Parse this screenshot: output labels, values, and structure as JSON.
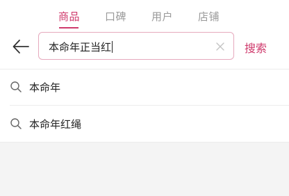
{
  "tabs": [
    {
      "label": "商品",
      "active": true
    },
    {
      "label": "口碑",
      "active": false
    },
    {
      "label": "用户",
      "active": false
    },
    {
      "label": "店铺",
      "active": false
    }
  ],
  "search": {
    "value": "本命年正当红",
    "button_label": "搜索"
  },
  "suggestions": [
    {
      "text": "本命年"
    },
    {
      "text": "本命年红绳"
    }
  ],
  "icons": {
    "back": "arrow-left-icon",
    "clear": "close-icon",
    "suggestion": "search-icon"
  },
  "colors": {
    "accent": "#cf3a6c",
    "tab_inactive": "#9a9a9a",
    "input_border": "#e6a9bd",
    "empty_area": "#f4f4f4"
  }
}
